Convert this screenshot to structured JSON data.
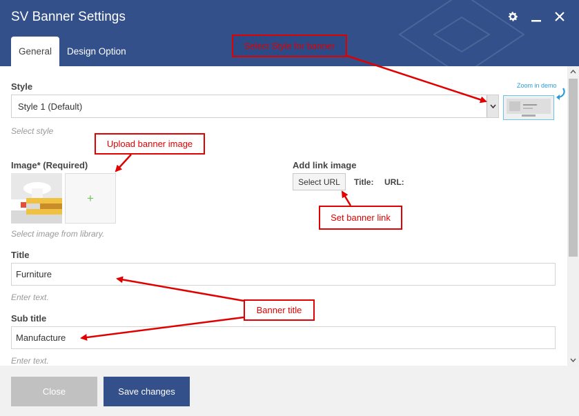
{
  "dialog": {
    "title": "SV Banner Settings",
    "tabs": [
      {
        "label": "General"
      },
      {
        "label": "Design Option"
      }
    ]
  },
  "style_field": {
    "label": "Style",
    "selected": "Style 1 (Default)",
    "hint": "Select style",
    "zoom_link": "Zoom in demo"
  },
  "image_field": {
    "label": "Image* (Required)",
    "add_glyph": "+",
    "hint": "Select image from library."
  },
  "link_field": {
    "label": "Add link image",
    "button": "Select URL",
    "title_label": "Title:",
    "url_label": "URL:"
  },
  "title_field": {
    "label": "Title",
    "value": "Furniture",
    "hint": "Enter text."
  },
  "subtitle_field": {
    "label": "Sub title",
    "value": "Manufacture",
    "hint": "Enter text."
  },
  "footer": {
    "close_label": "Close",
    "save_label": "Save changes"
  },
  "annotations": {
    "select_style": "Select Style for banner",
    "upload_image": "Upload banner image",
    "set_link": "Set banner link",
    "banner_title": "Banner title"
  },
  "colors": {
    "header": "#33508a",
    "accent_red": "#e00000",
    "close_button": "#c1c1c1",
    "save_button": "#33508a"
  }
}
